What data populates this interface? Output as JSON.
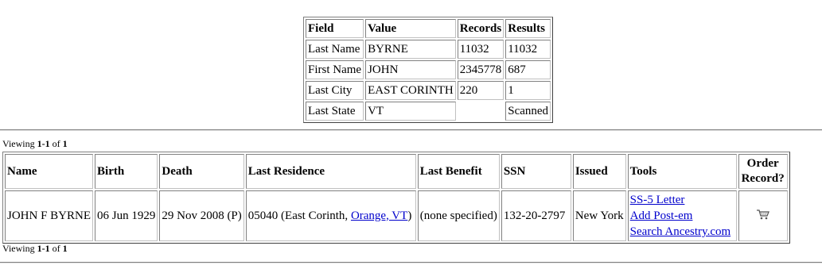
{
  "summary": {
    "headers": [
      "Field",
      "Value",
      "Records",
      "Results"
    ],
    "rows": [
      {
        "field": "Last Name",
        "value": "BYRNE",
        "records": "11032",
        "results": "11032"
      },
      {
        "field": "First Name",
        "value": "JOHN",
        "records": "2345778",
        "results": "687"
      },
      {
        "field": "Last City",
        "value": "EAST CORINTH",
        "records": "220",
        "results": "1"
      },
      {
        "field": "Last State",
        "value": "VT",
        "records": "",
        "results": "Scanned"
      }
    ]
  },
  "viewing": {
    "prefix": "Viewing ",
    "range": "1-1",
    "of": " of ",
    "total": "1"
  },
  "results": {
    "headers": {
      "name": "Name",
      "birth": "Birth",
      "death": "Death",
      "residence": "Last Residence",
      "benefit": "Last Benefit",
      "ssn": "SSN",
      "issued": "Issued",
      "tools": "Tools",
      "order": "Order Record?"
    },
    "row": {
      "name": "JOHN F BYRNE",
      "birth": "06 Jun 1929",
      "death": "29 Nov 2008 (P)",
      "residence_prefix": "05040 (East Corinth, ",
      "residence_link": "Orange, VT",
      "residence_suffix": ")",
      "benefit": "(none specified)",
      "ssn": "132-20-2797",
      "issued": "New York",
      "tools": [
        "SS-5 Letter",
        "Add Post-em",
        "Search Ancestry.com"
      ],
      "order_icon": "shopping-cart-icon"
    }
  },
  "colors": {
    "link": "#0000cc"
  }
}
